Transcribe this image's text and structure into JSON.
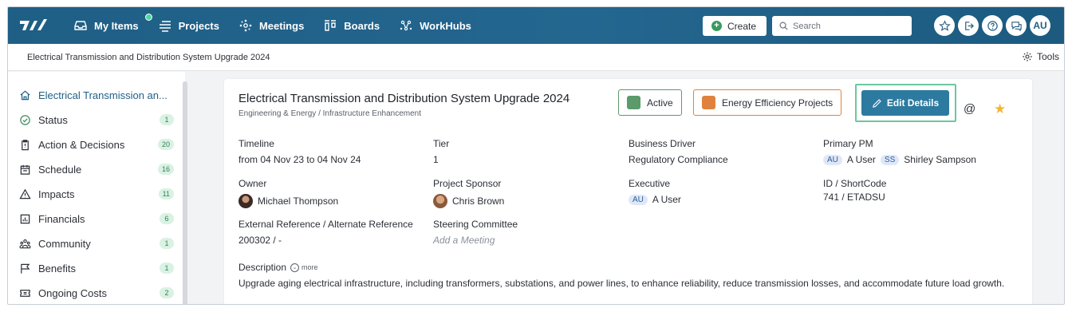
{
  "nav": {
    "logo": "logo",
    "items": [
      {
        "label": "My Items",
        "icon": "inbox-icon"
      },
      {
        "label": "Projects",
        "icon": "projects-icon"
      },
      {
        "label": "Meetings",
        "icon": "meetings-icon"
      },
      {
        "label": "Boards",
        "icon": "boards-icon"
      },
      {
        "label": "WorkHubs",
        "icon": "workhubs-icon"
      }
    ],
    "create_label": "Create",
    "search_placeholder": "Search",
    "user_initials": "AU"
  },
  "breadcrumb": "Electrical Transmission and Distribution System Upgrade 2024",
  "tools_label": "Tools",
  "sidebar": {
    "items": [
      {
        "label": "Electrical Transmission an...",
        "badge": ""
      },
      {
        "label": "Status",
        "badge": "1"
      },
      {
        "label": "Action & Decisions",
        "badge": "20"
      },
      {
        "label": "Schedule",
        "badge": "16"
      },
      {
        "label": "Impacts",
        "badge": "11"
      },
      {
        "label": "Financials",
        "badge": "6"
      },
      {
        "label": "Community",
        "badge": "1"
      },
      {
        "label": "Benefits",
        "badge": "1"
      },
      {
        "label": "Ongoing Costs",
        "badge": "2"
      }
    ]
  },
  "project": {
    "title": "Electrical Transmission and Distribution System Upgrade 2024",
    "subtitle": "Engineering & Energy / Infrastructure Enhancement",
    "status_label": "Active",
    "status_color": "#5b9a6b",
    "category_label": "Energy Efficiency Projects",
    "category_color": "#e0823e",
    "edit_label": "Edit Details",
    "fields": {
      "timeline_label": "Timeline",
      "timeline_value": "from 04 Nov 23 to 04 Nov 24",
      "tier_label": "Tier",
      "tier_value": "1",
      "business_driver_label": "Business Driver",
      "business_driver_value": "Regulatory Compliance",
      "primary_pm_label": "Primary PM",
      "primary_pm_1_initials": "AU",
      "primary_pm_1_name": "A User",
      "primary_pm_2_initials": "SS",
      "primary_pm_2_name": "Shirley Sampson",
      "owner_label": "Owner",
      "owner_value": "Michael Thompson",
      "sponsor_label": "Project Sponsor",
      "sponsor_value": "Chris Brown",
      "executive_label": "Executive",
      "executive_initials": "AU",
      "executive_name": "A User",
      "id_label": "ID / ShortCode",
      "id_value": "741 / ETADSU",
      "extref_label": "External Reference / Alternate Reference",
      "extref_value": "200302 / -",
      "steering_label": "Steering Committee",
      "steering_value": "Add a Meeting"
    },
    "description_label": "Description",
    "more_label": "more",
    "description": "Upgrade aging electrical infrastructure, including transformers, substations, and power lines, to enhance reliability, reduce transmission losses, and accommodate future load growth."
  }
}
